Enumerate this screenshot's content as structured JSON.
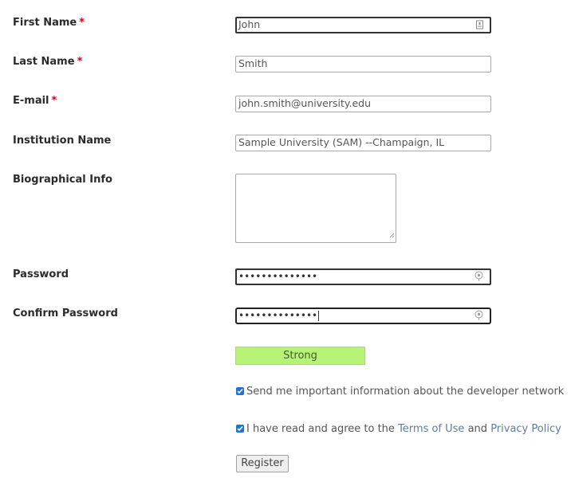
{
  "form": {
    "fields": {
      "first_name": {
        "label": "First Name",
        "required_mark": "*",
        "value": "John",
        "icon": "contact-card-icon"
      },
      "last_name": {
        "label": "Last Name",
        "required_mark": "*",
        "value": "Smith"
      },
      "email": {
        "label": "E-mail",
        "required_mark": "*",
        "value": "john.smith@university.edu"
      },
      "institution": {
        "label": "Institution Name",
        "value": "Sample University (SAM) --Champaign, IL"
      },
      "bio": {
        "label": "Biographical Info",
        "value": ""
      },
      "password": {
        "label": "Password",
        "masked_value": "••••••••••••••",
        "icon": "password-key-icon"
      },
      "confirm_password": {
        "label": "Confirm Password",
        "masked_value": "••••••••••••••",
        "icon": "password-key-icon"
      }
    },
    "strength_meter": {
      "label": "Strong",
      "color": "#b6f276"
    },
    "checkboxes": {
      "newsletter": {
        "checked": true,
        "label": "Send me important information about the developer network"
      },
      "terms": {
        "checked": true,
        "prefix": "I have read and agree to the",
        "terms_link": "Terms of Use",
        "conjunction": "and",
        "privacy_link": "Privacy Policy"
      }
    },
    "submit_label": "Register"
  },
  "colors": {
    "required": "#d0021b",
    "checkbox": "#1e73d8",
    "link": "#5b7da3"
  }
}
